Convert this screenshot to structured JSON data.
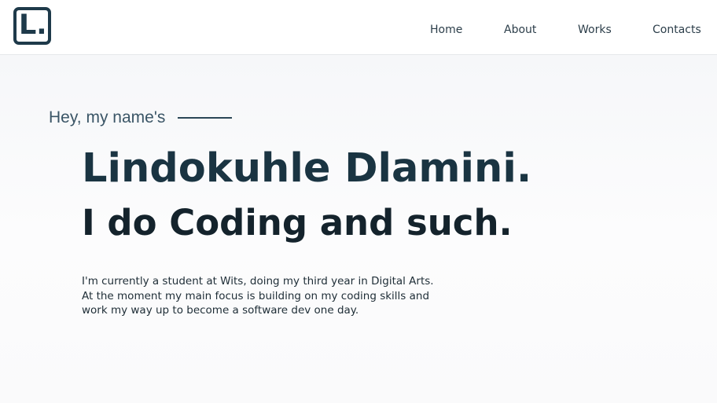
{
  "logo": {
    "mark": "L."
  },
  "nav": {
    "home": "Home",
    "about": "About",
    "works": "Works",
    "contacts": "Contacts"
  },
  "hero": {
    "intro": "Hey, my name's",
    "name": "Lindokuhle Dlamini.",
    "tagline": "I do Coding and such.",
    "bio_lines": [
      "I'm currently a student at Wits, doing my third year in Digital Arts.",
      "At the moment my main focus is building on my coding skills and",
      "work my way up to become a software dev one day."
    ]
  },
  "colors": {
    "primary": "#1e3a4a",
    "background": "#f8f9fa",
    "navbar": "#ffffff"
  }
}
